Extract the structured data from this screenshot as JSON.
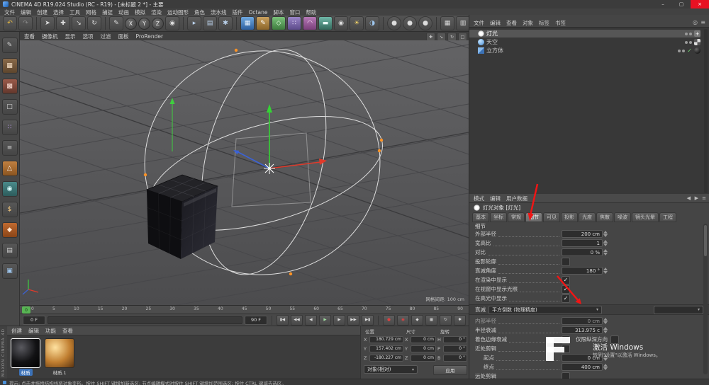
{
  "window": {
    "title": "CINEMA 4D R19.024 Studio (RC - R19) - [未标题 2 *] - 主要",
    "minimize": "–",
    "maximize": "▢",
    "close": "×"
  },
  "menubar": {
    "items": [
      "文件",
      "编辑",
      "创建",
      "选择",
      "工具",
      "网格",
      "捕捉",
      "动画",
      "模拟",
      "渲染",
      "运动图形",
      "角色",
      "流水线",
      "插件",
      "Octane",
      "脚本",
      "窗口",
      "帮助"
    ]
  },
  "toolbar": {
    "axis_x": "X",
    "axis_y": "Y",
    "axis_z": "Z"
  },
  "icons": {
    "undo": "↶",
    "redo": "↷",
    "select": "➤",
    "move": "✚",
    "scale": "↘",
    "rotate": "↻",
    "last_tool": "✎",
    "coord_system": "◉",
    "render_view": "▸",
    "render_pv": "▤",
    "render_settings": "✱",
    "add_cube": "▦",
    "add_spline": "✎",
    "add_generator": "◇",
    "add_array": "∷",
    "add_deformer": "◠",
    "add_floor": "▬",
    "add_camera": "◉",
    "add_light": "☀",
    "add_sky": "◑",
    "octane": "●",
    "display_a": "▦",
    "display_b": "▥",
    "gear": "✱",
    "red_dot": "●",
    "om_search": "◎",
    "om_filter": "≡",
    "vp_pan": "✚",
    "vp_zoom": "↘",
    "vp_rotate": "↻",
    "vp_toggle": "□",
    "mode_prev": "◀",
    "mode_next": "▶",
    "mode_menu": "≡",
    "dropdown": "▾"
  },
  "left_toolbar": {
    "glyphs": [
      "✎",
      "▦",
      "▩",
      "□",
      "∷",
      "≡",
      "△",
      "◉",
      "$",
      "◆",
      "▤",
      "▣"
    ]
  },
  "viewport": {
    "menu": [
      "查看",
      "摄像机",
      "显示",
      "选项",
      "过滤",
      "面板",
      "ProRender"
    ],
    "grid_label": "网格间距: 100 cm"
  },
  "timeline": {
    "playhead": "0",
    "ticks": [
      "0",
      "5",
      "10",
      "15",
      "20",
      "25",
      "30",
      "35",
      "40",
      "45",
      "50",
      "55",
      "60",
      "65",
      "70",
      "75",
      "80",
      "85",
      "90"
    ],
    "current": "0 F",
    "range_end": "90 F"
  },
  "transport": {
    "go_start": "▮◀",
    "prev_key": "◀◀",
    "prev_frame": "◀",
    "play": "▶",
    "next_frame": "▶",
    "next_key": "▶▶",
    "go_end": "▶▮",
    "record": "●",
    "autokey": "◉",
    "key_pos": "◆",
    "key_scale": "▦",
    "key_rot": "↻",
    "key_param": "✱"
  },
  "materials": {
    "menu": [
      "创建",
      "编辑",
      "功能",
      "查看"
    ],
    "items": [
      {
        "name": "材质"
      },
      {
        "name": "材质.1"
      }
    ]
  },
  "coordinates": {
    "columns": [
      "位置",
      "尺寸",
      "旋转"
    ],
    "rows": [
      {
        "l1": "X",
        "v1": "180.729 cm",
        "l2": "X",
        "v2": "0 cm",
        "l3": "H",
        "v3": "0 °"
      },
      {
        "l1": "Y",
        "v1": "157.402 cm",
        "l2": "Y",
        "v2": "0 cm",
        "l3": "P",
        "v3": "0 °"
      },
      {
        "l1": "Z",
        "v1": "-180.227 cm",
        "l2": "Z",
        "v2": "0 cm",
        "l3": "B",
        "v3": "0 °"
      }
    ],
    "mode": "对象(相对)",
    "apply": "应用"
  },
  "object_manager": {
    "menu": [
      "文件",
      "编辑",
      "查看",
      "对象",
      "标签",
      "书签"
    ],
    "objects": [
      {
        "name": "灯光"
      },
      {
        "name": "天空"
      },
      {
        "name": "立方体"
      }
    ]
  },
  "attributes": {
    "mode_menu": [
      "模式",
      "编辑",
      "用户数据"
    ],
    "title": "灯光对象 [灯光]",
    "tabs": [
      "基本",
      "坐标",
      "常规",
      "细节",
      "可见",
      "投影",
      "光度",
      "焦散",
      "噪波",
      "镜头光晕",
      "工程"
    ],
    "active_tab": "细节",
    "section": "细节",
    "rows": [
      {
        "label": "外部半径",
        "value": "200 cm"
      },
      {
        "label": "宽高比",
        "value": "1"
      },
      {
        "label": "对比",
        "value": "0 %"
      },
      {
        "label": "投影轮廓",
        "check": ""
      },
      {
        "label": "衰减角度",
        "value": "180 °"
      },
      {
        "label": "在渲染中显示",
        "check": "✓"
      },
      {
        "label": "在视窗中显示光照",
        "check": "✓"
      },
      {
        "label": "在高光中显示",
        "check": "✓"
      }
    ],
    "falloff_label": "衰减",
    "falloff_value": "平方倒数 (物理精度)",
    "post_rows": [
      {
        "label": "内部半径",
        "value": "0 cm"
      },
      {
        "label": "半径衰减",
        "value": "313.975 c"
      },
      {
        "label": "着色边缘衰减",
        "check": "",
        "label2": "仅限纵深方向",
        "check2": ""
      },
      {
        "label": "近处剪辑",
        "check": ""
      },
      {
        "label": "起点",
        "value": "0 cm"
      },
      {
        "label": "终点",
        "value": "400 cm"
      },
      {
        "label": "远处剪辑",
        "check": ""
      }
    ]
  },
  "watermark": {
    "line1": "激活 Windows",
    "line2": "转到\"设置\"以激活 Windows。"
  },
  "statusbar": {
    "tip": "提示: 点击并拖拽结构线将对象变形。按住 SHIFT 键增加新选区: 节点编辑模式时按住 SHIFT 键增加范围选区; 按住 CTRL 键减去选区。"
  },
  "brand": {
    "vertical": "MAXON CINEMA 4D"
  }
}
